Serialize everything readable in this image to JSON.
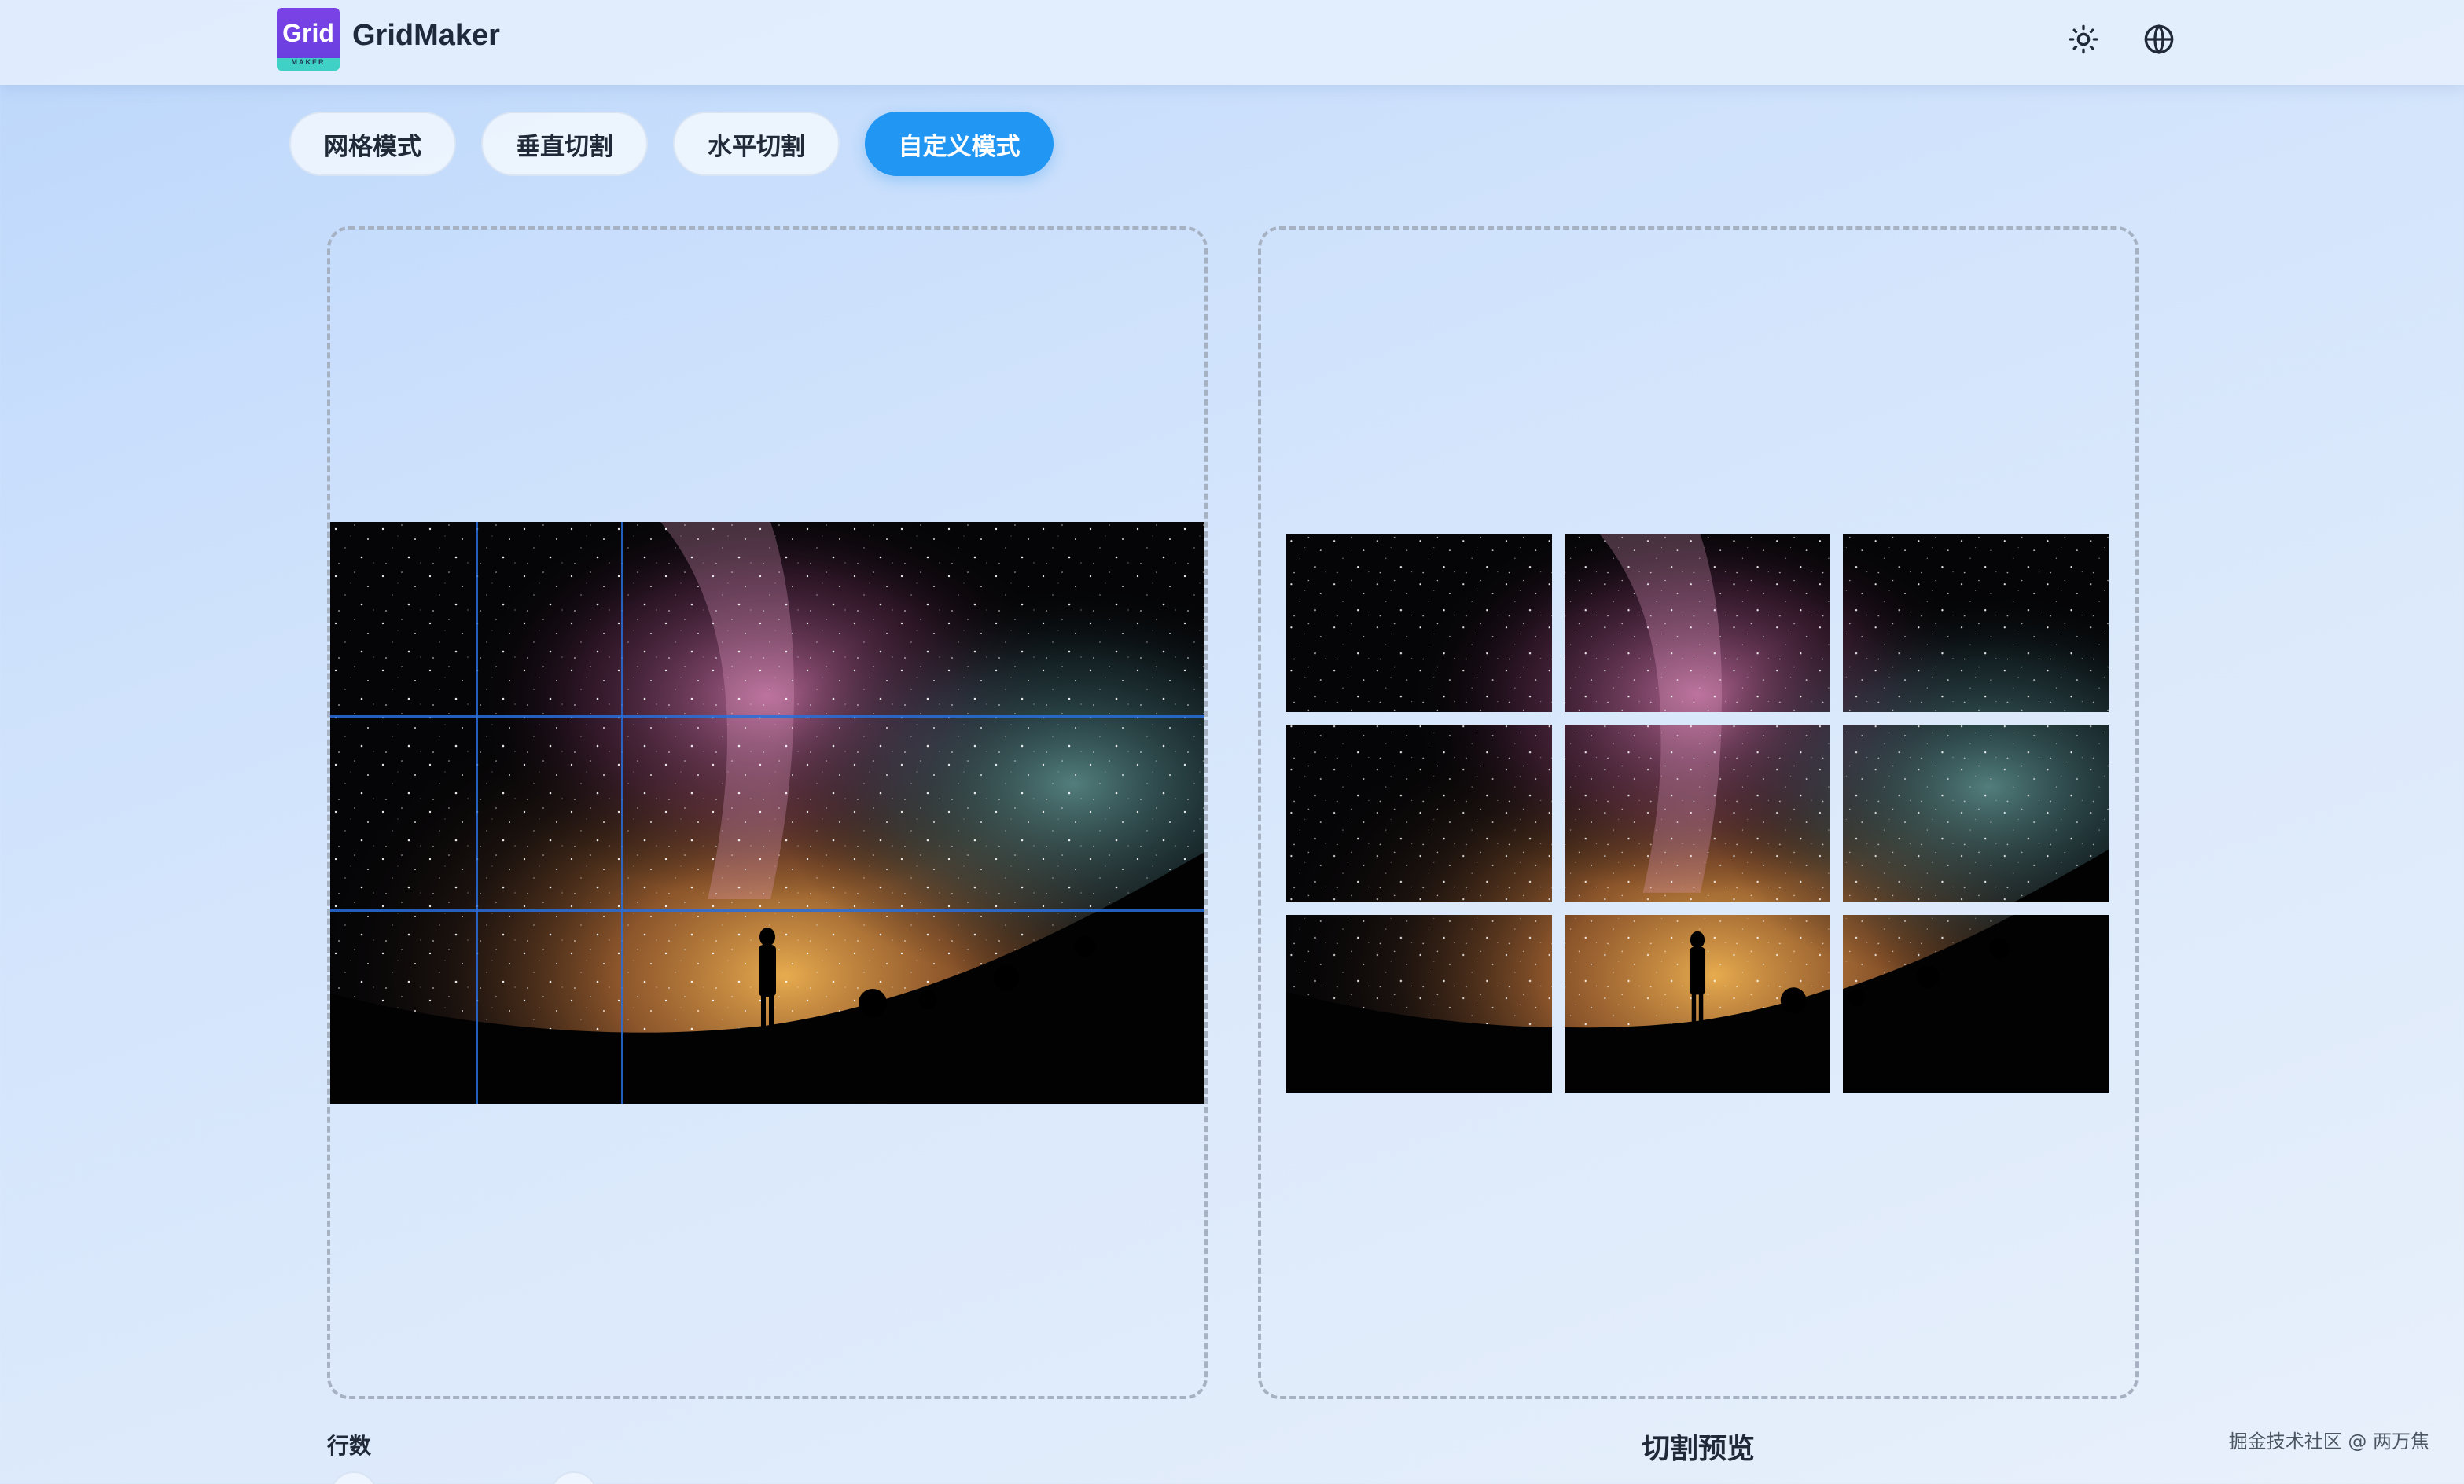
{
  "header": {
    "logo_text": "Grid",
    "logo_subtext": "MAKER",
    "app_name": "GridMaker"
  },
  "tabs": [
    {
      "label": "网格模式",
      "active": false
    },
    {
      "label": "垂直切割",
      "active": false
    },
    {
      "label": "水平切割",
      "active": false
    },
    {
      "label": "自定义模式",
      "active": true
    }
  ],
  "grid": {
    "rows": 3,
    "cols": 3
  },
  "controls": {
    "rows_label": "行数"
  },
  "preview": {
    "label": "切割预览"
  },
  "watermark": "掘金技术社区 @ 两万焦",
  "colors": {
    "accent": "#2196f3",
    "logo_purple": "#6a3fe0",
    "logo_teal": "#3fd1c6",
    "grid_line": "#286edc"
  },
  "icons": {
    "theme": "sun-icon",
    "language": "globe-icon"
  }
}
